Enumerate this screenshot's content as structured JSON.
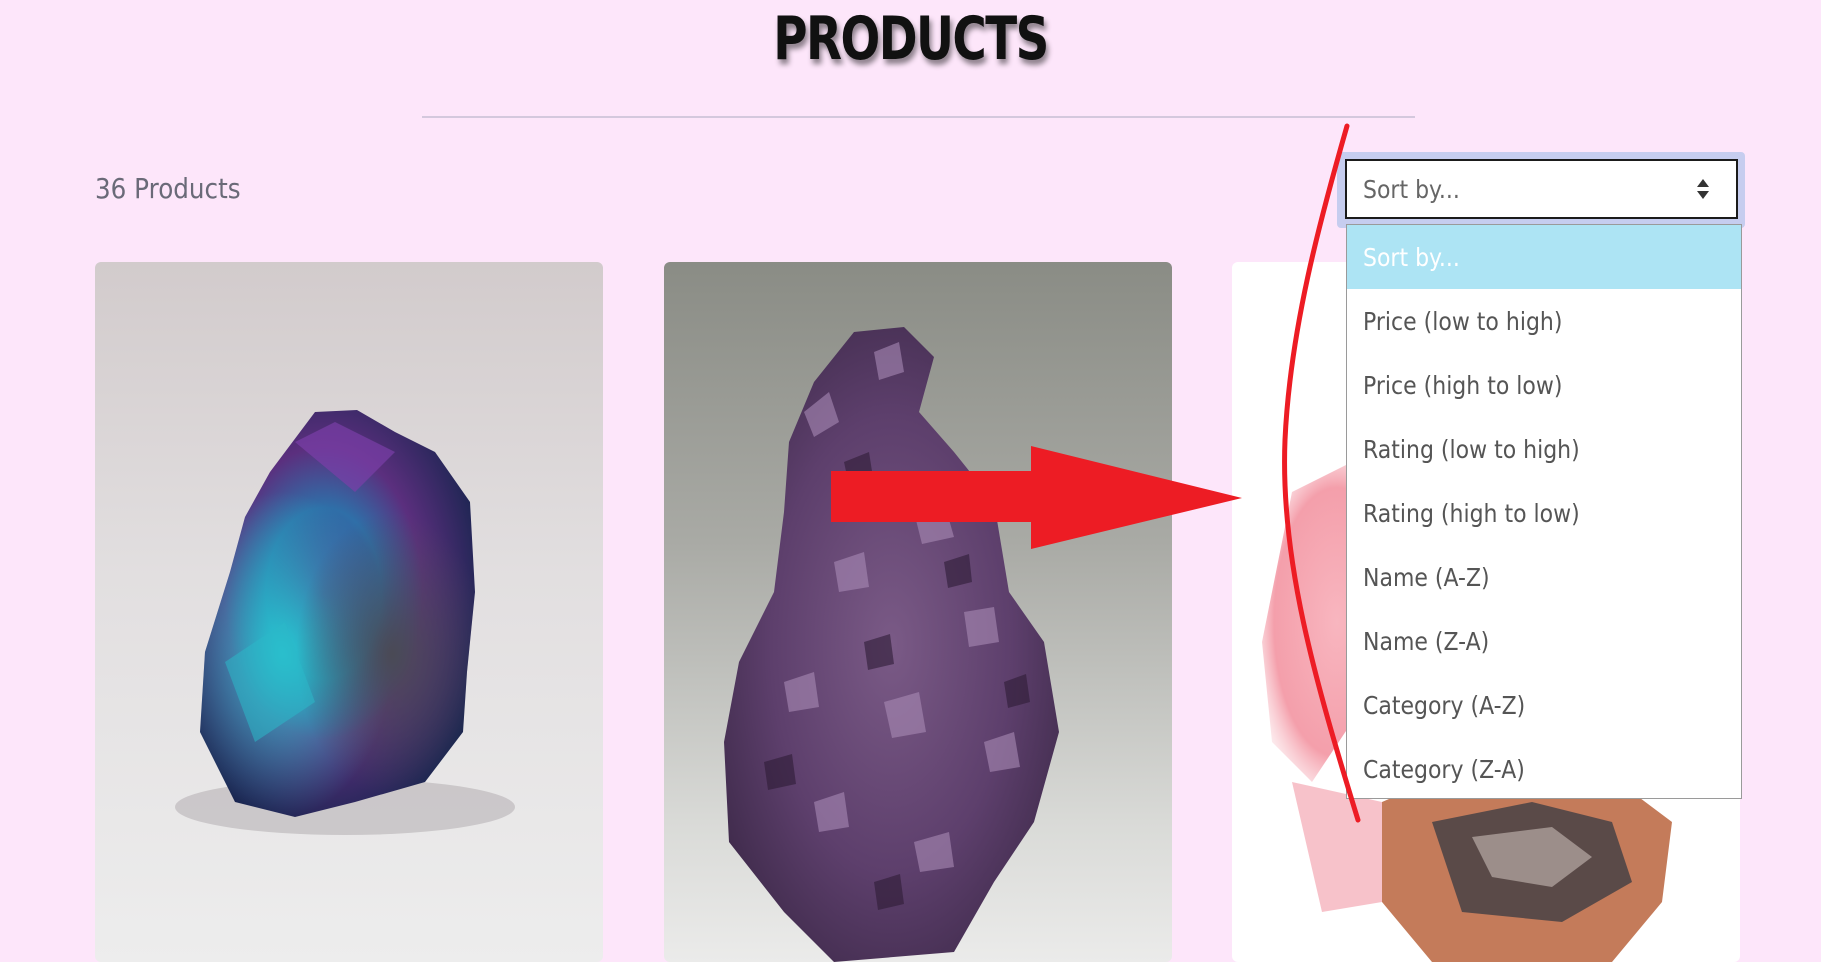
{
  "header": {
    "title": "PRODUCTS"
  },
  "toolbar": {
    "product_count": "36 Products",
    "sort": {
      "selected": "Sort by...",
      "options": [
        "Sort by...",
        "Price (low to high)",
        "Price (high to low)",
        "Rating (low to high)",
        "Rating (high to low)",
        "Name (A-Z)",
        "Name (Z-A)",
        "Category (A-Z)",
        "Category (Z-A)"
      ],
      "highlight_color": "#ade4f4"
    }
  },
  "products": [
    {
      "image": "iridescent-blue-purple-mineral-photo"
    },
    {
      "image": "purple-amethyst-cluster-photo"
    },
    {
      "image": "pink-mineral-photo"
    }
  ],
  "annotations": {
    "color": "#ed1c24",
    "arrow": "pointing-right",
    "curve": "red-hand-drawn-line"
  },
  "colors": {
    "background": "#fde6fa",
    "title": "#111111",
    "focus_ring": "#c6cdef"
  }
}
